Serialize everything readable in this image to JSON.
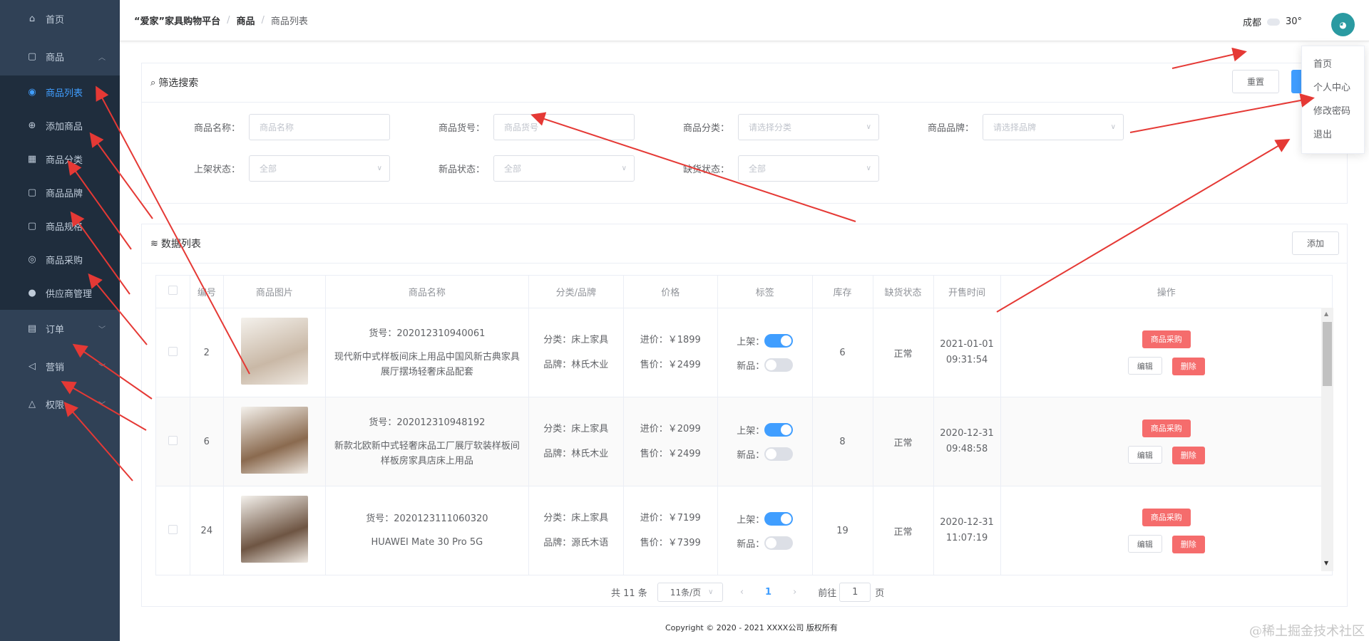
{
  "sidebar": {
    "items": [
      {
        "label": "首页",
        "icon": "home-icon"
      },
      {
        "label": "商品",
        "icon": "bag-icon",
        "expanded": true
      }
    ],
    "product_sub": [
      {
        "label": "商品列表",
        "icon": "location-icon",
        "active": true
      },
      {
        "label": "添加商品",
        "icon": "plus-circle-icon"
      },
      {
        "label": "商品分类",
        "icon": "grid-icon"
      },
      {
        "label": "商品品牌",
        "icon": "bag-icon"
      },
      {
        "label": "商品规格",
        "icon": "bag-icon"
      },
      {
        "label": "商品采购",
        "icon": "target-icon"
      },
      {
        "label": "供应商管理",
        "icon": "user-icon"
      }
    ],
    "bottom_items": [
      {
        "label": "订单",
        "icon": "document-icon"
      },
      {
        "label": "营销",
        "icon": "megaphone-icon"
      },
      {
        "label": "权限",
        "icon": "bell-icon"
      }
    ]
  },
  "header": {
    "breadcrumb": [
      "“爱家”家具购物平台",
      "商品",
      "商品列表"
    ],
    "city": "成都",
    "temp": "30°",
    "dropdown": [
      "首页",
      "个人中心",
      "修改密码",
      "退出"
    ]
  },
  "filter": {
    "title": "筛选搜索",
    "reset_label": "重置",
    "fields": {
      "name_label": "商品名称：",
      "name_ph": "商品名称",
      "sku_label": "商品货号：",
      "sku_ph": "商品货号",
      "cat_label": "商品分类：",
      "cat_ph": "请选择分类",
      "brand_label": "商品品牌：",
      "brand_ph": "请选择品牌",
      "shelf_label": "上架状态：",
      "shelf_val": "全部",
      "new_label": "新品状态：",
      "new_val": "全部",
      "stock_label": "缺货状态：",
      "stock_val": "全部"
    }
  },
  "list": {
    "title": "数据列表",
    "add_label": "添加",
    "columns": [
      "编号",
      "商品图片",
      "商品名称",
      "分类/品牌",
      "价格",
      "标签",
      "库存",
      "缺货状态",
      "开售时间",
      "操作"
    ],
    "rows": [
      {
        "id": "2",
        "sku": "货号：202012310940061",
        "name": "现代新中式样板间床上用品中国风新古典家具展厅摆场轻奢床品配套",
        "category": "分类：床上家具",
        "brand": "品牌：林氏木业",
        "cost": "进价：￥1899",
        "price": "售价：￥2499",
        "tag_on_label": "上架：",
        "tag_new_label": "新品：",
        "on_shelf": true,
        "is_new": false,
        "stock": "6",
        "status": "正常",
        "date": "2021-01-01",
        "time": "09:31:54",
        "img_color": "#c9b8a6"
      },
      {
        "id": "6",
        "sku": "货号：202012310948192",
        "name": "新款北欧新中式轻奢床品工厂展厅软装样板间样板房家具店床上用品",
        "category": "分类：床上家具",
        "brand": "品牌：林氏木业",
        "cost": "进价：￥2099",
        "price": "售价：￥2499",
        "tag_on_label": "上架：",
        "tag_new_label": "新品：",
        "on_shelf": true,
        "is_new": false,
        "stock": "8",
        "status": "正常",
        "date": "2020-12-31",
        "time": "09:48:58",
        "img_color": "#8a6a4f"
      },
      {
        "id": "24",
        "sku": "货号：2020123111060320",
        "name": "HUAWEI Mate 30 Pro 5G",
        "category": "分类：床上家具",
        "brand": "品牌：源氏木语",
        "cost": "进价：￥7199",
        "price": "售价：￥7399",
        "tag_on_label": "上架：",
        "tag_new_label": "新品：",
        "on_shelf": true,
        "is_new": false,
        "stock": "19",
        "status": "正常",
        "date": "2020-12-31",
        "time": "11:07:19",
        "img_color": "#6e5543"
      }
    ],
    "op_purchase": "商品采购",
    "op_edit": "编辑",
    "op_delete": "删除"
  },
  "pager": {
    "total": "共 11 条",
    "size": "11条/页",
    "current": "1",
    "goto_label": "前往",
    "goto_val": "1",
    "page_suffix": "页"
  },
  "footer": "Copyright © 2020 - 2021  XXXX公司 版权所有",
  "watermark": "@稀土掘金技术社区",
  "colors": {
    "sidebar": "#304156",
    "submenu": "#1f2d3d",
    "primary": "#409eff",
    "danger": "#f56c6c",
    "arrow": "#e53935"
  }
}
